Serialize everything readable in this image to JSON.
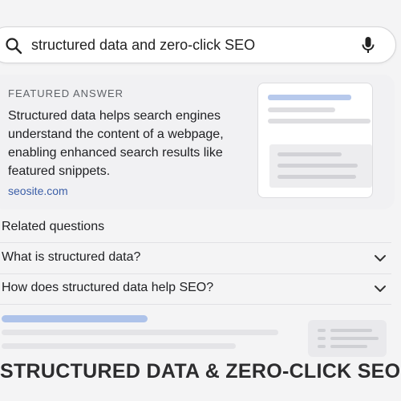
{
  "search": {
    "query": "structured data and zero-click SEO",
    "left_icon": "search-icon",
    "right_icon": "mic-icon"
  },
  "featured": {
    "label": "FEATURED ANSWER",
    "text": "Structured data helps search engines understand the content of a webpage, enabling enhanced search results like featured snippets.",
    "source": "seosite.com"
  },
  "related": {
    "heading": "Related questions",
    "questions": [
      {
        "text": "What is structured data?",
        "icon": "chevron-down-icon"
      },
      {
        "text": "How does structured data help SEO?",
        "icon": "chevron-down-icon"
      }
    ]
  },
  "footer": {
    "title": "STRUCTURED DATA & ZERO-CLICK SEO"
  },
  "colors": {
    "link": "#3c5fa8",
    "accent_placeholder": "#aec3ea",
    "background": "#f4f4f5"
  }
}
